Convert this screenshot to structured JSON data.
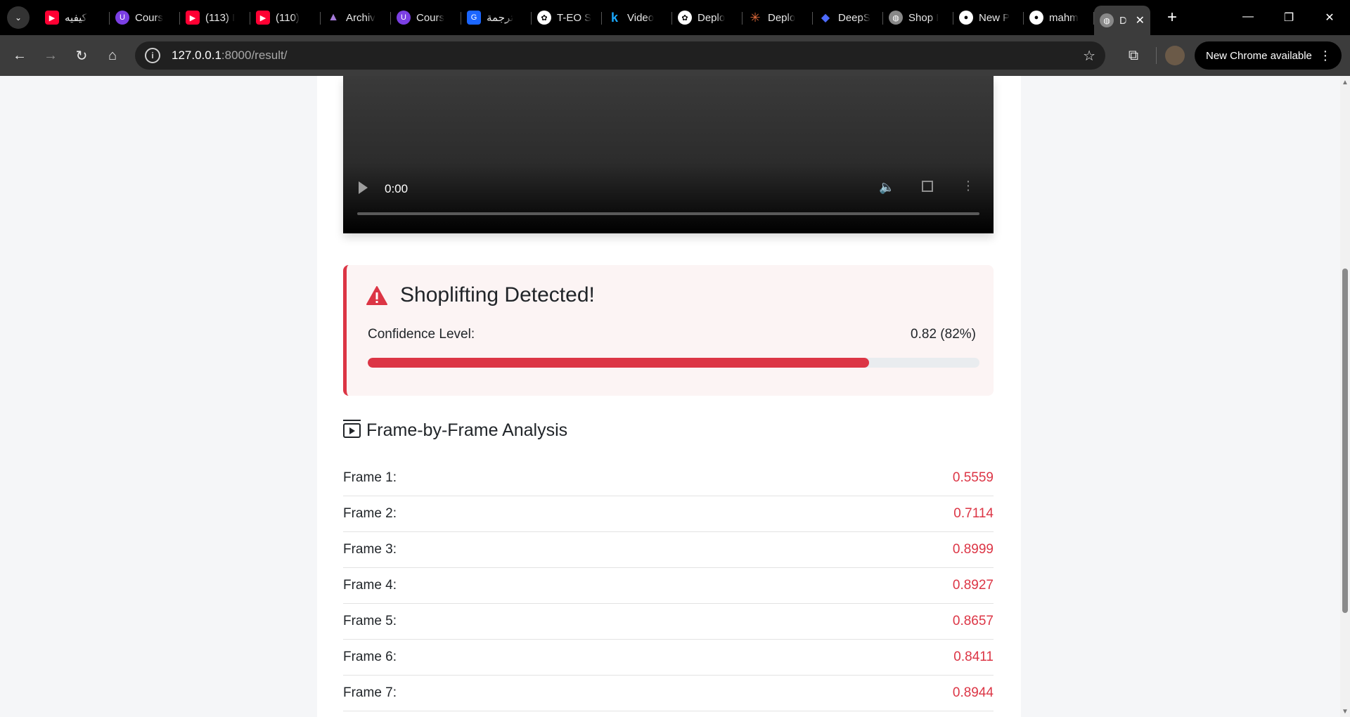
{
  "browser": {
    "tabs": [
      {
        "title": "كيفيه",
        "icon": "youtube-icon",
        "fav": "fav-yt",
        "glyph": "▶"
      },
      {
        "title": "Cours",
        "icon": "course-icon",
        "fav": "fav-purple",
        "glyph": "U"
      },
      {
        "title": "(113) I",
        "icon": "youtube-icon",
        "fav": "fav-yt",
        "glyph": "▶"
      },
      {
        "title": "(110)",
        "icon": "youtube-icon",
        "fav": "fav-yt",
        "glyph": "▶"
      },
      {
        "title": "Archiv",
        "icon": "archive-icon",
        "fav": "fav-arch",
        "glyph": "▲"
      },
      {
        "title": "Cours",
        "icon": "course-icon",
        "fav": "fav-purple",
        "glyph": "U"
      },
      {
        "title": "ترجمة",
        "icon": "translate-icon",
        "fav": "fav-blue",
        "glyph": "G"
      },
      {
        "title": "T-EO S",
        "icon": "chatgpt-icon",
        "fav": "fav-white",
        "glyph": "✿"
      },
      {
        "title": "Video",
        "icon": "k-icon",
        "fav": "fav-k",
        "glyph": "k"
      },
      {
        "title": "Deplo",
        "icon": "chatgpt-icon",
        "fav": "fav-white",
        "glyph": "✿"
      },
      {
        "title": "Deplo",
        "icon": "claude-icon",
        "fav": "fav-orange",
        "glyph": "✳"
      },
      {
        "title": "DeepS",
        "icon": "deepseek-icon",
        "fav": "fav-deep",
        "glyph": "◆"
      },
      {
        "title": "Shop I",
        "icon": "globe-icon",
        "fav": "fav-gray",
        "glyph": "◍"
      },
      {
        "title": "New P",
        "icon": "github-icon",
        "fav": "fav-white",
        "glyph": "●"
      },
      {
        "title": "mahm",
        "icon": "github-icon",
        "fav": "fav-white",
        "glyph": "●"
      }
    ],
    "active_tab": {
      "title": "D",
      "close": "✕"
    },
    "url_host": "127.0.0.1",
    "url_path": ":8000/result/",
    "update_label": "New Chrome available"
  },
  "video": {
    "time": "0:00"
  },
  "result": {
    "title": "Shoplifting Detected!",
    "confidence_label": "Confidence Level:",
    "confidence_value": "0.82 (82%)",
    "confidence_fraction": 0.82,
    "accent_color": "#dc3545"
  },
  "analysis": {
    "title": "Frame-by-Frame Analysis",
    "frames": [
      {
        "label": "Frame 1:",
        "value": "0.5559"
      },
      {
        "label": "Frame 2:",
        "value": "0.7114"
      },
      {
        "label": "Frame 3:",
        "value": "0.8999"
      },
      {
        "label": "Frame 4:",
        "value": "0.8927"
      },
      {
        "label": "Frame 5:",
        "value": "0.8657"
      },
      {
        "label": "Frame 6:",
        "value": "0.8411"
      },
      {
        "label": "Frame 7:",
        "value": "0.8944"
      }
    ]
  }
}
